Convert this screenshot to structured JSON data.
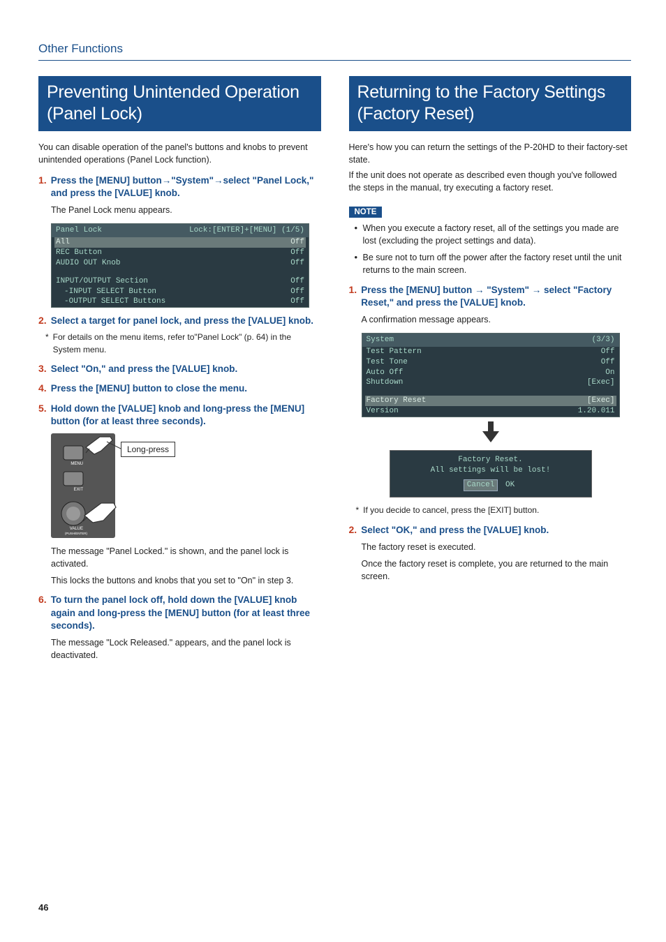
{
  "header": {
    "title": "Other Functions"
  },
  "page_number": "46",
  "left": {
    "h2": "Preventing Unintended Operation (Panel Lock)",
    "intro": "You can disable operation of the panel's buttons and knobs to prevent unintended operations (Panel Lock function).",
    "steps": [
      {
        "num": "1.",
        "title": "Press the [MENU] button→\"System\"→select \"Panel Lock,\" and press the [VALUE] knob.",
        "body": "The Panel Lock menu appears."
      },
      {
        "num": "2.",
        "title": "Select a target for panel lock, and press the [VALUE] knob."
      },
      {
        "num": "3.",
        "title": "Select \"On,\" and press the [VALUE] knob."
      },
      {
        "num": "4.",
        "title": "Press the [MENU] button to close the menu."
      },
      {
        "num": "5.",
        "title": "Hold down the [VALUE] knob and long-press the [MENU] button (for at least three seconds)."
      },
      {
        "num": "6.",
        "title": "To turn the panel lock off, hold down the [VALUE] knob again and long-press the [MENU] button (for at least three seconds).",
        "body": "The message \"Lock Released.\" appears, and the panel lock is deactivated."
      }
    ],
    "step2_note": "For details on the menu items, refer to\"Panel Lock\" (p. 64) in the System menu.",
    "step5_body1": "The message \"Panel Locked.\" is shown, and the panel lock is activated.",
    "step5_body2": "This locks the buttons and knobs that you set to \"On\" in step 3.",
    "longpress_label": "Long-press",
    "diagram_labels": {
      "menu": "MENU",
      "exit": "EXIT",
      "value": "VALUE",
      "push": "(PUSH/ENTER)"
    },
    "screenshot": {
      "title_left": "Panel Lock",
      "title_right": "Lock:[ENTER]+[MENU] (1/5)",
      "rows": [
        {
          "l": "All",
          "r": "Off",
          "hi": true
        },
        {
          "l": "REC Button",
          "r": "Off"
        },
        {
          "l": "AUDIO OUT Knob",
          "r": "Off"
        },
        {
          "blank": true
        },
        {
          "l": "INPUT/OUTPUT Section",
          "r": "Off"
        },
        {
          "l": "-INPUT SELECT Button",
          "r": "Off",
          "indent": true
        },
        {
          "l": "-OUTPUT SELECT Buttons",
          "r": "Off",
          "indent": true
        }
      ]
    }
  },
  "right": {
    "h2": "Returning to the Factory Settings (Factory Reset)",
    "intro1": "Here's how you can return the settings of the P-20HD to their factory-set state.",
    "intro2": "If the unit does not operate as described even though you've followed the steps in the manual, try executing a factory reset.",
    "note_label": "NOTE",
    "notes": [
      "When you execute a factory reset, all of the settings you made are lost (excluding the project settings and data).",
      "Be sure not to turn off the power after the factory reset until the unit returns to the main screen."
    ],
    "steps": [
      {
        "num": "1.",
        "title": "Press the [MENU] button → \"System\" → select \"Factory Reset,\" and press the [VALUE] knob.",
        "body": "A confirmation message appears."
      },
      {
        "num": "2.",
        "title": "Select \"OK,\" and press the [VALUE] knob.",
        "body1": "The factory reset is executed.",
        "body2": "Once the factory reset is complete, you are returned to the main screen."
      }
    ],
    "cancel_note": "If you decide to cancel, press the [EXIT] button.",
    "screenshot": {
      "title_left": "System",
      "title_right": "(3/3)",
      "rows": [
        {
          "l": "Test Pattern",
          "r": "Off"
        },
        {
          "l": "Test Tone",
          "r": "Off"
        },
        {
          "l": "Auto Off",
          "r": "On"
        },
        {
          "l": "Shutdown",
          "r": "[Exec]"
        },
        {
          "blank": true
        },
        {
          "l": "Factory Reset",
          "r": "[Exec]",
          "hi": true
        },
        {
          "l": "Version",
          "r": "1.20.011"
        }
      ]
    },
    "popup": {
      "line1": "Factory Reset.",
      "line2": "All settings will be lost!",
      "cancel": "Cancel",
      "ok": "OK"
    }
  }
}
